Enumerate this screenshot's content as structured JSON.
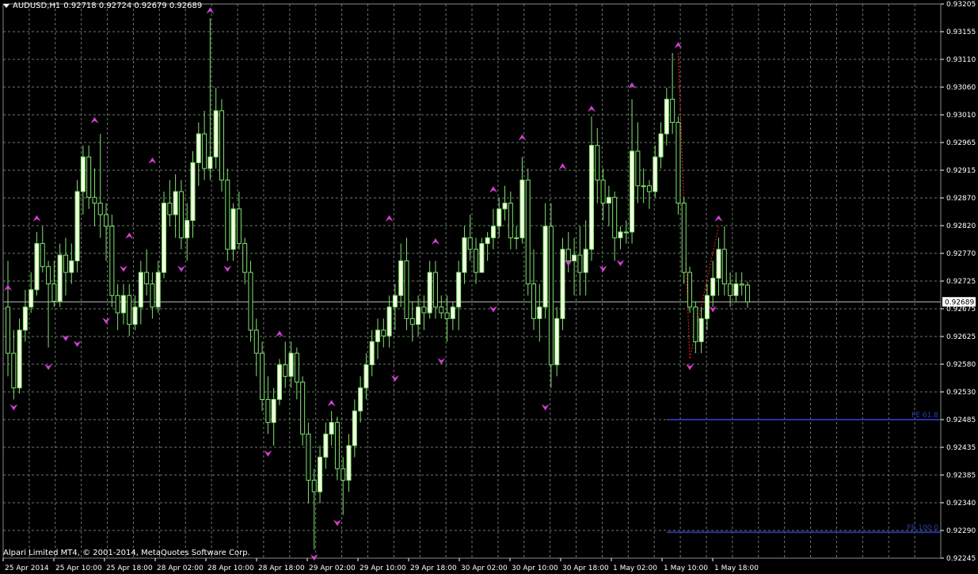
{
  "header": {
    "symbol": "AUDUSD,H1",
    "ohlc": "0.92718 0.92724 0.92679 0.92689"
  },
  "copyright": "Alpari Limited MT4, © 2001-2014, MetaQuotes Software Corp.",
  "colors": {
    "background": "#000000",
    "grid": "#6b7a6b",
    "candle": "#7fe36f",
    "candle_body": "#f4ffe0",
    "arrow": "#d43fd4",
    "fe_line": "#2733a6",
    "current_price_line": "#b9c4b9",
    "zigzag": "#ff2020"
  },
  "chart_data": {
    "type": "candlestick",
    "symbol": "AUDUSD",
    "timeframe": "H1",
    "ylim": [
      0.92245,
      0.93205
    ],
    "y_ticks": [
      "0.93205",
      "0.93155",
      "0.93110",
      "0.93060",
      "0.93010",
      "0.92965",
      "0.92915",
      "0.92870",
      "0.92820",
      "0.92770",
      "0.92725",
      "0.92675",
      "0.92625",
      "0.92580",
      "0.92530",
      "0.92485",
      "0.92435",
      "0.92385",
      "0.92340",
      "0.92290",
      "0.92245"
    ],
    "x_ticks": [
      "25 Apr 2014",
      "25 Apr 10:00",
      "25 Apr 18:00",
      "28 Apr 02:00",
      "28 Apr 10:00",
      "28 Apr 18:00",
      "29 Apr 02:00",
      "29 Apr 10:00",
      "29 Apr 18:00",
      "30 Apr 02:00",
      "30 Apr 10:00",
      "30 Apr 18:00",
      "1 May 02:00",
      "1 May 10:00",
      "1 May 18:00"
    ],
    "current_price": 0.92689,
    "current_price_label": "0.92689",
    "grid": true,
    "candles": [
      [
        0.9268,
        0.9276,
        0.9256,
        0.926
      ],
      [
        0.926,
        0.9264,
        0.9252,
        0.9254
      ],
      [
        0.9254,
        0.9266,
        0.9253,
        0.9264
      ],
      [
        0.9264,
        0.9271,
        0.9262,
        0.9268
      ],
      [
        0.9268,
        0.9274,
        0.9267,
        0.9271
      ],
      [
        0.9271,
        0.9281,
        0.927,
        0.9279
      ],
      [
        0.9279,
        0.9282,
        0.9274,
        0.9275
      ],
      [
        0.9275,
        0.9276,
        0.9261,
        0.9272
      ],
      [
        0.9272,
        0.9276,
        0.9268,
        0.9269
      ],
      [
        0.9269,
        0.9279,
        0.9268,
        0.9277
      ],
      [
        0.9277,
        0.928,
        0.927,
        0.9274
      ],
      [
        0.9274,
        0.9279,
        0.9272,
        0.9276
      ],
      [
        0.9276,
        0.929,
        0.9274,
        0.9288
      ],
      [
        0.9288,
        0.9296,
        0.9284,
        0.9294
      ],
      [
        0.9294,
        0.9296,
        0.9285,
        0.9287
      ],
      [
        0.9287,
        0.9292,
        0.9282,
        0.9286
      ],
      [
        0.9286,
        0.9298,
        0.928,
        0.9284
      ],
      [
        0.9284,
        0.9286,
        0.9276,
        0.9282
      ],
      [
        0.9282,
        0.9284,
        0.9268,
        0.927
      ],
      [
        0.927,
        0.9272,
        0.9264,
        0.9267
      ],
      [
        0.9267,
        0.9272,
        0.9265,
        0.927
      ],
      [
        0.927,
        0.9272,
        0.9263,
        0.9265
      ],
      [
        0.9265,
        0.927,
        0.9264,
        0.9268
      ],
      [
        0.9268,
        0.9276,
        0.9265,
        0.9274
      ],
      [
        0.9274,
        0.9278,
        0.927,
        0.9272
      ],
      [
        0.9272,
        0.9274,
        0.9266,
        0.9268
      ],
      [
        0.9268,
        0.9276,
        0.9267,
        0.9274
      ],
      [
        0.9274,
        0.9288,
        0.9273,
        0.9286
      ],
      [
        0.9286,
        0.929,
        0.9282,
        0.9284
      ],
      [
        0.9284,
        0.9291,
        0.928,
        0.9288
      ],
      [
        0.9288,
        0.929,
        0.9278,
        0.928
      ],
      [
        0.928,
        0.9286,
        0.9276,
        0.9283
      ],
      [
        0.9283,
        0.9295,
        0.928,
        0.9293
      ],
      [
        0.9293,
        0.93,
        0.9289,
        0.9298
      ],
      [
        0.9298,
        0.9302,
        0.929,
        0.9292
      ],
      [
        0.9292,
        0.9318,
        0.929,
        0.9294
      ],
      [
        0.9294,
        0.9306,
        0.9292,
        0.9302
      ],
      [
        0.9302,
        0.9304,
        0.9288,
        0.929
      ],
      [
        0.929,
        0.9292,
        0.9276,
        0.9278
      ],
      [
        0.9278,
        0.9286,
        0.9276,
        0.9285
      ],
      [
        0.9285,
        0.9288,
        0.9278,
        0.9279
      ],
      [
        0.9279,
        0.928,
        0.9272,
        0.9274
      ],
      [
        0.9274,
        0.9276,
        0.9262,
        0.9264
      ],
      [
        0.9264,
        0.9266,
        0.9256,
        0.926
      ],
      [
        0.926,
        0.9262,
        0.925,
        0.9252
      ],
      [
        0.9252,
        0.9256,
        0.9246,
        0.9248
      ],
      [
        0.9248,
        0.9254,
        0.9244,
        0.9252
      ],
      [
        0.9252,
        0.9259,
        0.9251,
        0.9258
      ],
      [
        0.9258,
        0.9262,
        0.9254,
        0.9256
      ],
      [
        0.9256,
        0.9262,
        0.9254,
        0.926
      ],
      [
        0.926,
        0.9261,
        0.9252,
        0.9255
      ],
      [
        0.9255,
        0.9256,
        0.9244,
        0.9246
      ],
      [
        0.9246,
        0.9248,
        0.9234,
        0.9238
      ],
      [
        0.9238,
        0.924,
        0.9226,
        0.9236
      ],
      [
        0.9236,
        0.9244,
        0.9234,
        0.9242
      ],
      [
        0.9242,
        0.9248,
        0.924,
        0.9246
      ],
      [
        0.9246,
        0.925,
        0.9244,
        0.9248
      ],
      [
        0.9248,
        0.9249,
        0.9238,
        0.924
      ],
      [
        0.924,
        0.9242,
        0.9232,
        0.9238
      ],
      [
        0.9238,
        0.9246,
        0.9236,
        0.9244
      ],
      [
        0.9244,
        0.9252,
        0.9242,
        0.925
      ],
      [
        0.925,
        0.9256,
        0.9248,
        0.9254
      ],
      [
        0.9254,
        0.926,
        0.9252,
        0.9258
      ],
      [
        0.9258,
        0.9264,
        0.9256,
        0.9262
      ],
      [
        0.9262,
        0.9266,
        0.9259,
        0.9264
      ],
      [
        0.9264,
        0.9266,
        0.9261,
        0.9263
      ],
      [
        0.9263,
        0.927,
        0.9261,
        0.9268
      ],
      [
        0.9268,
        0.9272,
        0.9264,
        0.927
      ],
      [
        0.927,
        0.9279,
        0.9268,
        0.9276
      ],
      [
        0.9276,
        0.928,
        0.9264,
        0.9266
      ],
      [
        0.9266,
        0.9269,
        0.9262,
        0.9265
      ],
      [
        0.9265,
        0.927,
        0.9263,
        0.9268
      ],
      [
        0.9268,
        0.927,
        0.9264,
        0.9267
      ],
      [
        0.9267,
        0.9276,
        0.9266,
        0.9274
      ],
      [
        0.9274,
        0.9276,
        0.9266,
        0.9268
      ],
      [
        0.9268,
        0.927,
        0.9266,
        0.9267
      ],
      [
        0.9267,
        0.927,
        0.9262,
        0.9266
      ],
      [
        0.9266,
        0.9269,
        0.9264,
        0.9268
      ],
      [
        0.9268,
        0.9276,
        0.9264,
        0.9274
      ],
      [
        0.9274,
        0.9282,
        0.9272,
        0.928
      ],
      [
        0.928,
        0.9284,
        0.9276,
        0.9278
      ],
      [
        0.9278,
        0.928,
        0.9272,
        0.9274
      ],
      [
        0.9274,
        0.928,
        0.9274,
        0.9279
      ],
      [
        0.9279,
        0.9281,
        0.9276,
        0.928
      ],
      [
        0.928,
        0.9285,
        0.9278,
        0.9282
      ],
      [
        0.9282,
        0.9287,
        0.928,
        0.9285
      ],
      [
        0.9285,
        0.9289,
        0.9283,
        0.9286
      ],
      [
        0.9286,
        0.9288,
        0.9278,
        0.928
      ],
      [
        0.928,
        0.9282,
        0.9278,
        0.928
      ],
      [
        0.928,
        0.9294,
        0.9279,
        0.929
      ],
      [
        0.929,
        0.9292,
        0.927,
        0.9272
      ],
      [
        0.9272,
        0.9278,
        0.9264,
        0.9266
      ],
      [
        0.9266,
        0.9272,
        0.9262,
        0.9268
      ],
      [
        0.9268,
        0.9286,
        0.9266,
        0.9282
      ],
      [
        0.9282,
        0.9286,
        0.9254,
        0.9258
      ],
      [
        0.9258,
        0.9268,
        0.9256,
        0.9266
      ],
      [
        0.9266,
        0.928,
        0.9264,
        0.9278
      ],
      [
        0.9278,
        0.9281,
        0.9274,
        0.9276
      ],
      [
        0.9276,
        0.928,
        0.927,
        0.9277
      ],
      [
        0.9277,
        0.9282,
        0.927,
        0.9274
      ],
      [
        0.9274,
        0.9283,
        0.927,
        0.9278
      ],
      [
        0.9278,
        0.9301,
        0.9276,
        0.9296
      ],
      [
        0.9296,
        0.9299,
        0.9286,
        0.929
      ],
      [
        0.929,
        0.9292,
        0.9283,
        0.9286
      ],
      [
        0.9286,
        0.9289,
        0.9282,
        0.9287
      ],
      [
        0.9287,
        0.9288,
        0.9276,
        0.928
      ],
      [
        0.928,
        0.9282,
        0.9278,
        0.9281
      ],
      [
        0.9281,
        0.9283,
        0.9279,
        0.9281
      ],
      [
        0.9281,
        0.9304,
        0.9279,
        0.9295
      ],
      [
        0.9295,
        0.93,
        0.9286,
        0.9289
      ],
      [
        0.9289,
        0.9292,
        0.9286,
        0.9289
      ],
      [
        0.9289,
        0.929,
        0.9285,
        0.9288
      ],
      [
        0.9288,
        0.9296,
        0.9287,
        0.9294
      ],
      [
        0.9294,
        0.93,
        0.9292,
        0.9298
      ],
      [
        0.9298,
        0.9306,
        0.9296,
        0.9304
      ],
      [
        0.9304,
        0.9312,
        0.9298,
        0.93
      ],
      [
        0.93,
        0.9301,
        0.9284,
        0.9286
      ],
      [
        0.9286,
        0.9287,
        0.9272,
        0.9274
      ],
      [
        0.9274,
        0.9275,
        0.9267,
        0.9268
      ],
      [
        0.9268,
        0.9269,
        0.926,
        0.9262
      ],
      [
        0.9262,
        0.9268,
        0.926,
        0.9266
      ],
      [
        0.9266,
        0.9272,
        0.9264,
        0.927
      ],
      [
        0.927,
        0.9276,
        0.9268,
        0.9273
      ],
      [
        0.9273,
        0.928,
        0.927,
        0.9278
      ],
      [
        0.9278,
        0.9282,
        0.927,
        0.9272
      ],
      [
        0.9272,
        0.9274,
        0.9268,
        0.927
      ],
      [
        0.927,
        0.9274,
        0.9269,
        0.9272
      ],
      [
        0.9272,
        0.9274,
        0.927,
        0.92718
      ],
      [
        0.92718,
        0.92724,
        0.92679,
        0.92689
      ]
    ],
    "up_arrows": [
      [
        0,
        0.927
      ],
      [
        5,
        0.9282
      ],
      [
        15,
        0.9299
      ],
      [
        21,
        0.9279
      ],
      [
        25,
        0.9292
      ],
      [
        35,
        0.9318
      ],
      [
        47,
        0.9262
      ],
      [
        56,
        0.925
      ],
      [
        66,
        0.9282
      ],
      [
        74,
        0.9278
      ],
      [
        84,
        0.9287
      ],
      [
        89,
        0.9296
      ],
      [
        96,
        0.9291
      ],
      [
        101,
        0.9301
      ],
      [
        108,
        0.9305
      ],
      [
        116,
        0.9312
      ],
      [
        123,
        0.9282
      ]
    ],
    "down_arrows": [
      [
        1,
        0.9252
      ],
      [
        7,
        0.9259
      ],
      [
        10,
        0.9264
      ],
      [
        12,
        0.9263
      ],
      [
        17,
        0.9267
      ],
      [
        20,
        0.9276
      ],
      [
        30,
        0.9276
      ],
      [
        38,
        0.9276
      ],
      [
        45,
        0.9244
      ],
      [
        53,
        0.9226
      ],
      [
        57,
        0.9232
      ],
      [
        67,
        0.9257
      ],
      [
        75,
        0.926
      ],
      [
        84,
        0.9269
      ],
      [
        93,
        0.9252
      ],
      [
        97,
        0.9277
      ],
      [
        103,
        0.9276
      ],
      [
        106,
        0.9277
      ],
      [
        118,
        0.9259
      ],
      [
        122,
        0.9269
      ]
    ],
    "fe_levels": [
      {
        "label": "FE 61.8",
        "value": 0.92485
      },
      {
        "label": "FE 100.0",
        "value": 0.9229
      }
    ]
  }
}
